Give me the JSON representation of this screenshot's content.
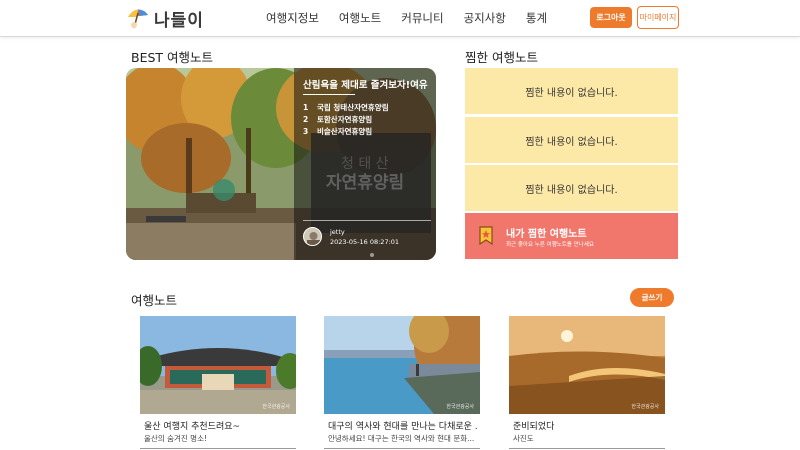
{
  "header": {
    "logo_text": "나들이",
    "nav": [
      "여행지정보",
      "여행노트",
      "커뮤니티",
      "공지사항",
      "통계"
    ],
    "login_label": "로그아웃",
    "mypage_label": "마이페이지"
  },
  "best": {
    "section_title": "BEST 여행노트",
    "headline": "산림욕을 제대로 즐겨보자!여유",
    "ranks": [
      {
        "num": "1",
        "name": "국립 청태산자연휴양림"
      },
      {
        "num": "2",
        "name": "토함산자연휴양림"
      },
      {
        "num": "3",
        "name": "비슬산자연휴양림"
      }
    ],
    "sign_text": "청태산 자연휴양림",
    "author": "jetty",
    "date": "2023-05-16 08:27:01"
  },
  "jjim": {
    "section_title": "찜한 여행노트",
    "empty_label": "찜한 내용이 없습니다.",
    "my_title": "내가 찜한 여행노트",
    "my_sub": "최근 좋아요 누른 여행노트를 만나세요"
  },
  "notes": {
    "section_title": "여행노트",
    "write_label": "글쓰기",
    "items": [
      {
        "title": "울산 여행지 추천드려요~",
        "sub": "울산의 숨겨진 명소!",
        "watermark": "한국관광공사"
      },
      {
        "title": "대구의 역사와 현대를 만나는 다채로운 ...",
        "sub": "안녕하세요! 대구는 한국의 역사와 현대 문화...",
        "watermark": "한국관광공사"
      },
      {
        "title": "준비되었다",
        "sub": "사진도",
        "watermark": "한국관광공사"
      }
    ]
  },
  "colors": {
    "accent": "#ee7a2b",
    "jjim_bg": "#fde9a7",
    "my_jjim_bg": "#f1776d"
  }
}
